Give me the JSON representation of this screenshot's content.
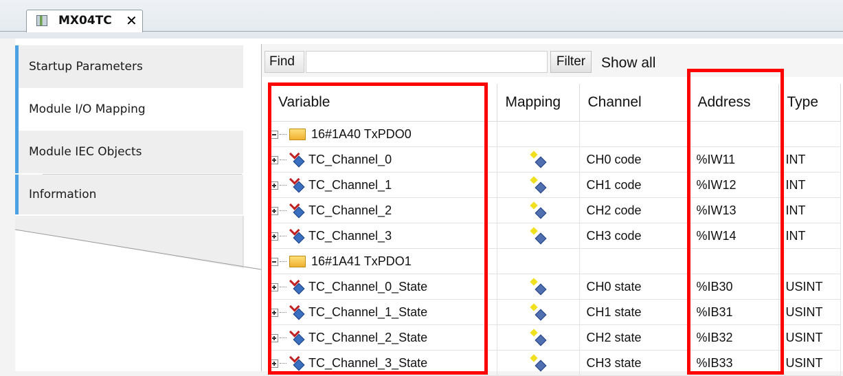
{
  "editor_tab": {
    "title": "MX04TC",
    "close": "✕"
  },
  "sidebar": {
    "items": [
      {
        "label": "Startup Parameters"
      },
      {
        "label": "Module I/O Mapping"
      },
      {
        "label": "Module IEC Objects"
      },
      {
        "label": "Information"
      }
    ],
    "active_index": 1
  },
  "toolbar": {
    "find_label": "Find",
    "find_value": "",
    "filter_label": "Filter",
    "filter_value": "Show all"
  },
  "grid": {
    "columns": [
      "Variable",
      "Mapping",
      "Channel",
      "Address",
      "Type"
    ],
    "groups": [
      {
        "name": "16#1A40 TxPDO0",
        "rows": [
          {
            "variable": "TC_Channel_0",
            "channel": "CH0 code",
            "address": "%IW11",
            "type": "INT"
          },
          {
            "variable": "TC_Channel_1",
            "channel": "CH1 code",
            "address": "%IW12",
            "type": "INT"
          },
          {
            "variable": "TC_Channel_2",
            "channel": "CH2 code",
            "address": "%IW13",
            "type": "INT"
          },
          {
            "variable": "TC_Channel_3",
            "channel": "CH3 code",
            "address": "%IW14",
            "type": "INT"
          }
        ]
      },
      {
        "name": "16#1A41 TxPDO1",
        "rows": [
          {
            "variable": "TC_Channel_0_State",
            "channel": "CH0 state",
            "address": "%IB30",
            "type": "USINT"
          },
          {
            "variable": "TC_Channel_1_State",
            "channel": "CH1 state",
            "address": "%IB31",
            "type": "USINT"
          },
          {
            "variable": "TC_Channel_2_State",
            "channel": "CH2 state",
            "address": "%IB32",
            "type": "USINT"
          },
          {
            "variable": "TC_Channel_3_State",
            "channel": "CH3 state",
            "address": "%IB33",
            "type": "USINT"
          }
        ]
      }
    ]
  },
  "colors": {
    "highlight": "#ff0000",
    "tab_accent": "#4aa0e0"
  }
}
